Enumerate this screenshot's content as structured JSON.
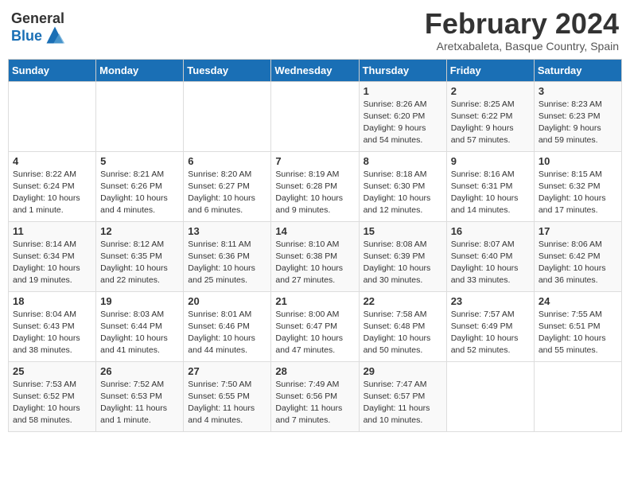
{
  "header": {
    "logo_general": "General",
    "logo_blue": "Blue",
    "title": "February 2024",
    "location": "Aretxabaleta, Basque Country, Spain"
  },
  "days_of_week": [
    "Sunday",
    "Monday",
    "Tuesday",
    "Wednesday",
    "Thursday",
    "Friday",
    "Saturday"
  ],
  "weeks": [
    [
      {
        "day": "",
        "info": ""
      },
      {
        "day": "",
        "info": ""
      },
      {
        "day": "",
        "info": ""
      },
      {
        "day": "",
        "info": ""
      },
      {
        "day": "1",
        "info": "Sunrise: 8:26 AM\nSunset: 6:20 PM\nDaylight: 9 hours\nand 54 minutes."
      },
      {
        "day": "2",
        "info": "Sunrise: 8:25 AM\nSunset: 6:22 PM\nDaylight: 9 hours\nand 57 minutes."
      },
      {
        "day": "3",
        "info": "Sunrise: 8:23 AM\nSunset: 6:23 PM\nDaylight: 9 hours\nand 59 minutes."
      }
    ],
    [
      {
        "day": "4",
        "info": "Sunrise: 8:22 AM\nSunset: 6:24 PM\nDaylight: 10 hours\nand 1 minute."
      },
      {
        "day": "5",
        "info": "Sunrise: 8:21 AM\nSunset: 6:26 PM\nDaylight: 10 hours\nand 4 minutes."
      },
      {
        "day": "6",
        "info": "Sunrise: 8:20 AM\nSunset: 6:27 PM\nDaylight: 10 hours\nand 6 minutes."
      },
      {
        "day": "7",
        "info": "Sunrise: 8:19 AM\nSunset: 6:28 PM\nDaylight: 10 hours\nand 9 minutes."
      },
      {
        "day": "8",
        "info": "Sunrise: 8:18 AM\nSunset: 6:30 PM\nDaylight: 10 hours\nand 12 minutes."
      },
      {
        "day": "9",
        "info": "Sunrise: 8:16 AM\nSunset: 6:31 PM\nDaylight: 10 hours\nand 14 minutes."
      },
      {
        "day": "10",
        "info": "Sunrise: 8:15 AM\nSunset: 6:32 PM\nDaylight: 10 hours\nand 17 minutes."
      }
    ],
    [
      {
        "day": "11",
        "info": "Sunrise: 8:14 AM\nSunset: 6:34 PM\nDaylight: 10 hours\nand 19 minutes."
      },
      {
        "day": "12",
        "info": "Sunrise: 8:12 AM\nSunset: 6:35 PM\nDaylight: 10 hours\nand 22 minutes."
      },
      {
        "day": "13",
        "info": "Sunrise: 8:11 AM\nSunset: 6:36 PM\nDaylight: 10 hours\nand 25 minutes."
      },
      {
        "day": "14",
        "info": "Sunrise: 8:10 AM\nSunset: 6:38 PM\nDaylight: 10 hours\nand 27 minutes."
      },
      {
        "day": "15",
        "info": "Sunrise: 8:08 AM\nSunset: 6:39 PM\nDaylight: 10 hours\nand 30 minutes."
      },
      {
        "day": "16",
        "info": "Sunrise: 8:07 AM\nSunset: 6:40 PM\nDaylight: 10 hours\nand 33 minutes."
      },
      {
        "day": "17",
        "info": "Sunrise: 8:06 AM\nSunset: 6:42 PM\nDaylight: 10 hours\nand 36 minutes."
      }
    ],
    [
      {
        "day": "18",
        "info": "Sunrise: 8:04 AM\nSunset: 6:43 PM\nDaylight: 10 hours\nand 38 minutes."
      },
      {
        "day": "19",
        "info": "Sunrise: 8:03 AM\nSunset: 6:44 PM\nDaylight: 10 hours\nand 41 minutes."
      },
      {
        "day": "20",
        "info": "Sunrise: 8:01 AM\nSunset: 6:46 PM\nDaylight: 10 hours\nand 44 minutes."
      },
      {
        "day": "21",
        "info": "Sunrise: 8:00 AM\nSunset: 6:47 PM\nDaylight: 10 hours\nand 47 minutes."
      },
      {
        "day": "22",
        "info": "Sunrise: 7:58 AM\nSunset: 6:48 PM\nDaylight: 10 hours\nand 50 minutes."
      },
      {
        "day": "23",
        "info": "Sunrise: 7:57 AM\nSunset: 6:49 PM\nDaylight: 10 hours\nand 52 minutes."
      },
      {
        "day": "24",
        "info": "Sunrise: 7:55 AM\nSunset: 6:51 PM\nDaylight: 10 hours\nand 55 minutes."
      }
    ],
    [
      {
        "day": "25",
        "info": "Sunrise: 7:53 AM\nSunset: 6:52 PM\nDaylight: 10 hours\nand 58 minutes."
      },
      {
        "day": "26",
        "info": "Sunrise: 7:52 AM\nSunset: 6:53 PM\nDaylight: 11 hours\nand 1 minute."
      },
      {
        "day": "27",
        "info": "Sunrise: 7:50 AM\nSunset: 6:55 PM\nDaylight: 11 hours\nand 4 minutes."
      },
      {
        "day": "28",
        "info": "Sunrise: 7:49 AM\nSunset: 6:56 PM\nDaylight: 11 hours\nand 7 minutes."
      },
      {
        "day": "29",
        "info": "Sunrise: 7:47 AM\nSunset: 6:57 PM\nDaylight: 11 hours\nand 10 minutes."
      },
      {
        "day": "",
        "info": ""
      },
      {
        "day": "",
        "info": ""
      }
    ]
  ]
}
